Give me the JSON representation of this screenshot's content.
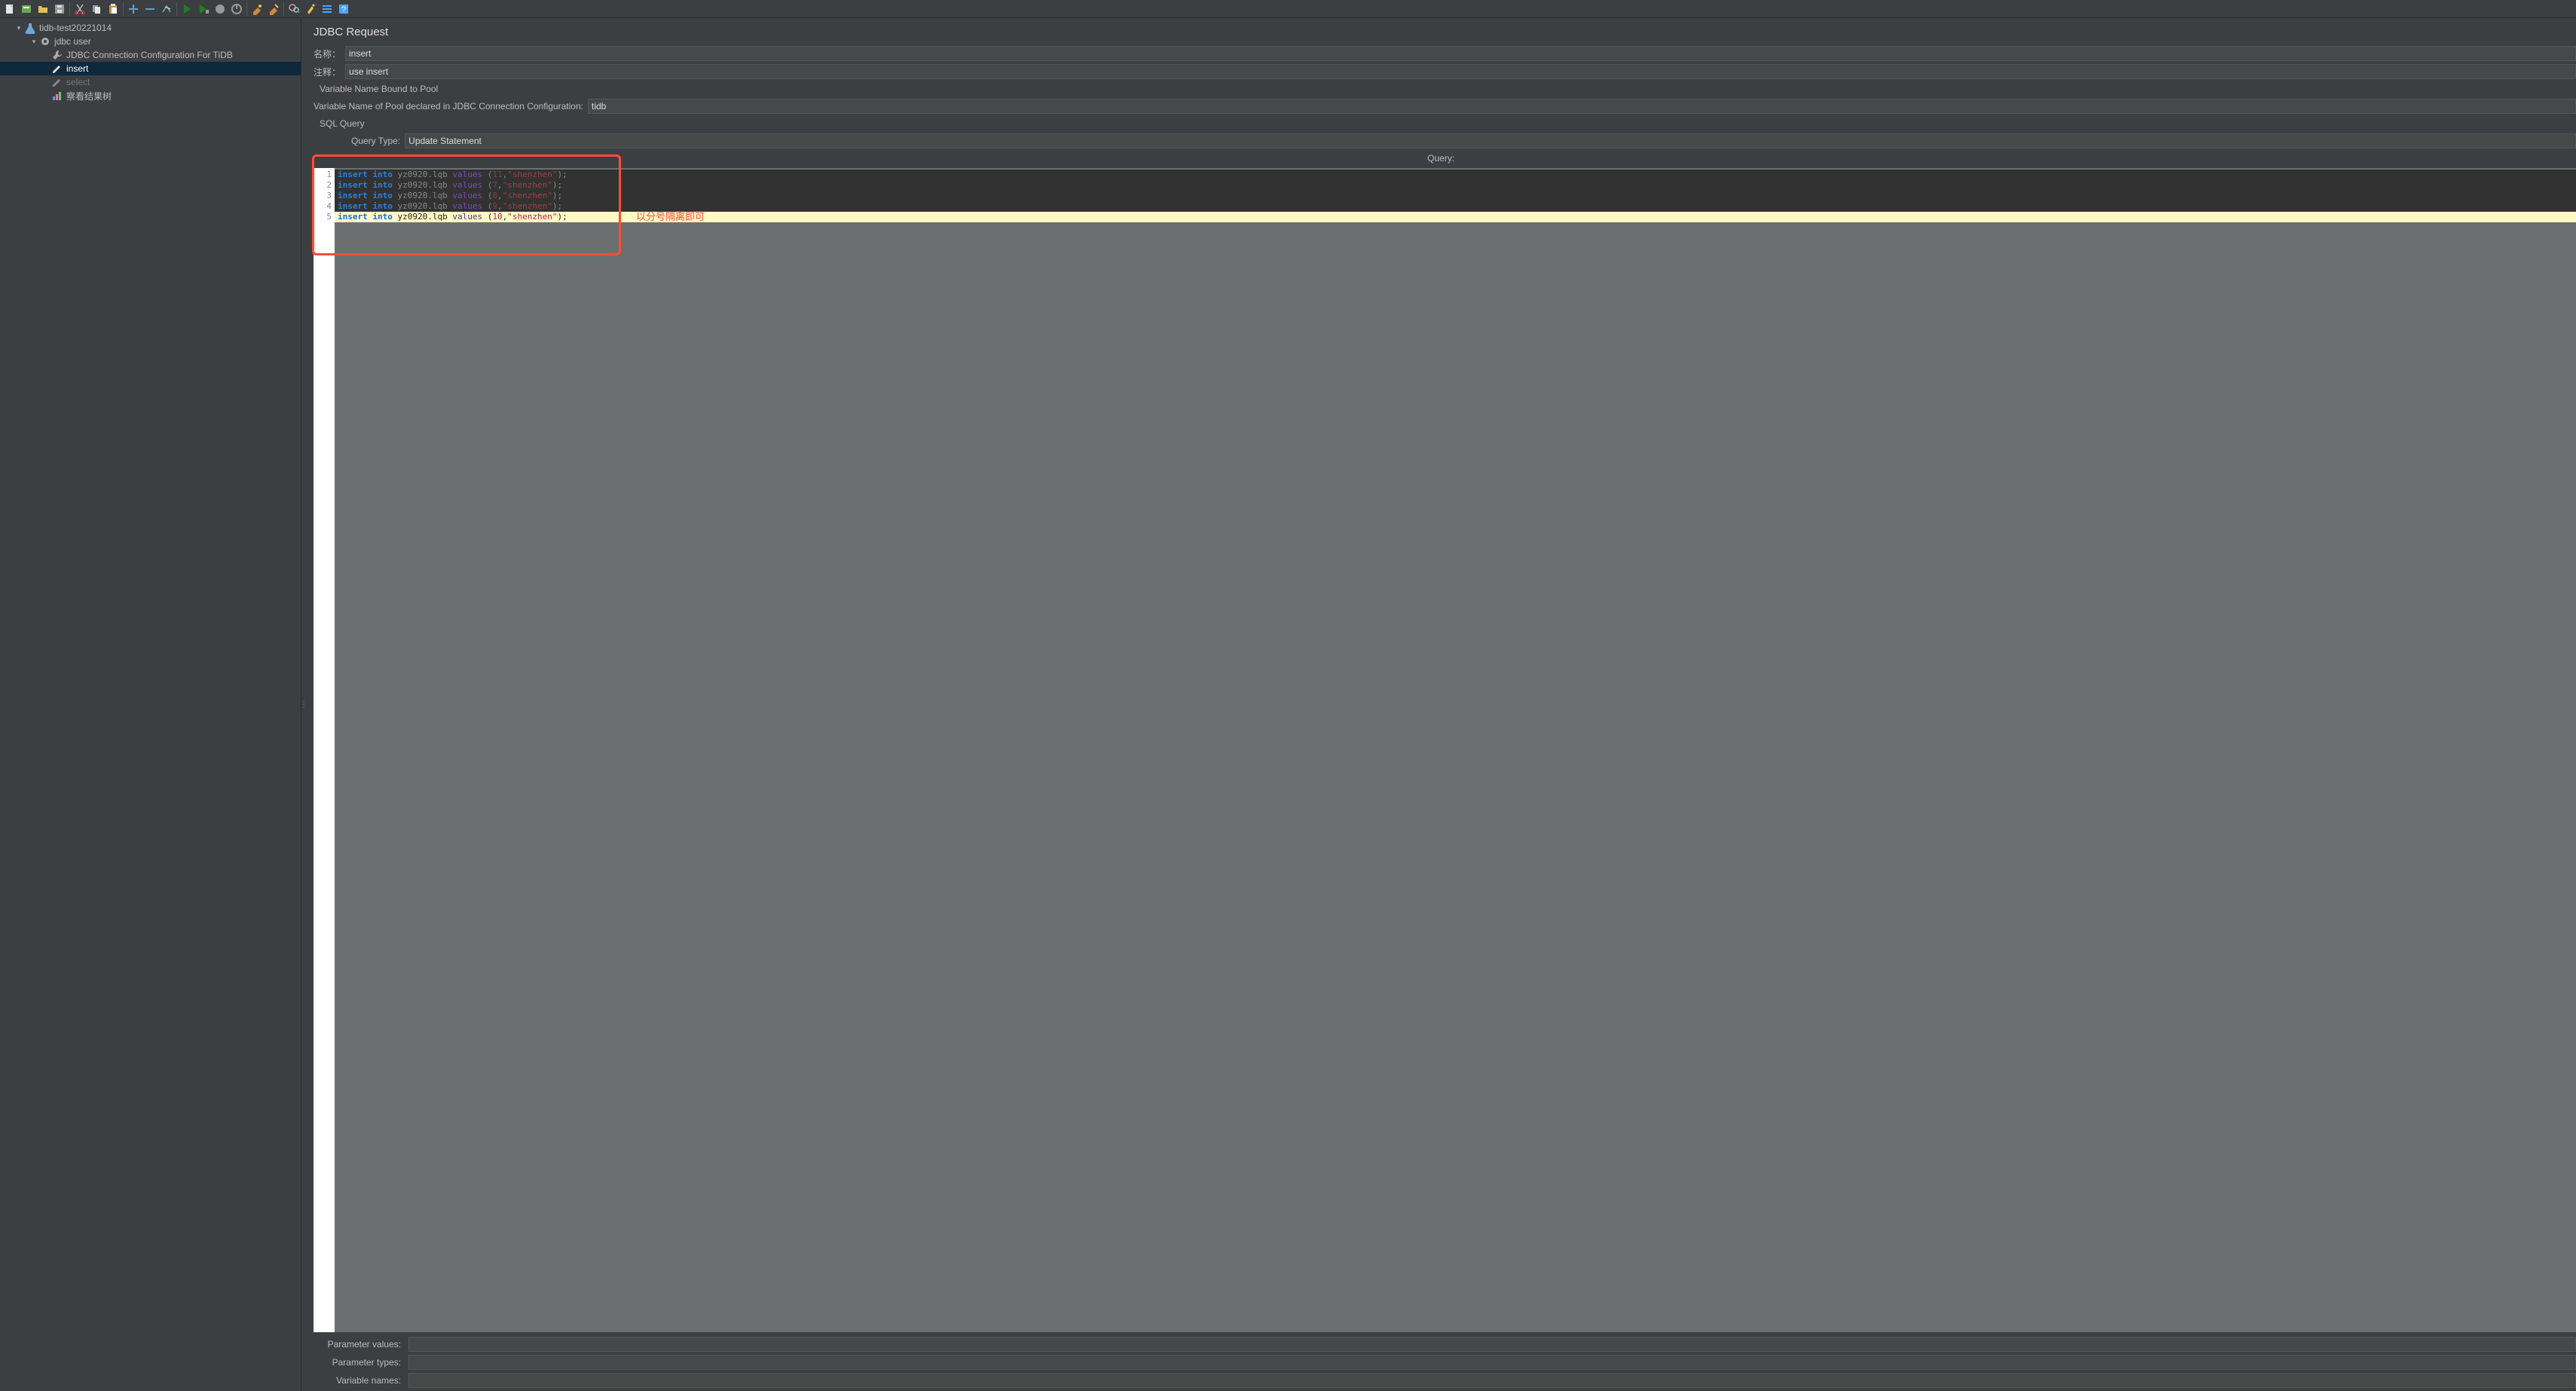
{
  "toolbar": {
    "icons": [
      "new-file-icon",
      "templates-icon",
      "open-icon",
      "save-icon",
      "cut-icon",
      "copy-icon",
      "paste-icon",
      "add-icon",
      "remove-icon",
      "toggle-icon",
      "run-icon",
      "run-nogui-icon",
      "stop-icon",
      "shutdown-icon",
      "clear-icon",
      "clear-all-icon",
      "search-icon",
      "function-helper-icon",
      "options-icon",
      "help-icon"
    ]
  },
  "tree": {
    "root": {
      "label": "tidb-test20221014"
    },
    "group": {
      "label": "jdbc user"
    },
    "config": {
      "label": "JDBC Connection Configuration For TiDB"
    },
    "req_insert": {
      "label": "insert"
    },
    "req_select": {
      "label": "select"
    },
    "listener": {
      "label": "察看结果树"
    }
  },
  "panel": {
    "title": "JDBC Request",
    "name_label": "名称：",
    "name_value": "insert",
    "comment_label": "注释：",
    "comment_value": "use insert",
    "var_bound_label": "Variable Name Bound to Pool",
    "pool_label": "Variable Name of Pool declared in JDBC Connection Configuration:",
    "pool_value": "tidb",
    "sql_query_label": "SQL Query",
    "query_type_label": "Query Type:",
    "query_type_value": "Update Statement",
    "query_header": "Query:"
  },
  "sql": {
    "lines": [
      {
        "n": "1",
        "kw1": "insert",
        "kw2": "into",
        "tbl": "yz0920.lqb",
        "vkw": "values",
        "open": "(",
        "a1": "11",
        "comma": ",",
        "a2": "\"shenzhen\"",
        "close": ")",
        "end": ";"
      },
      {
        "n": "2",
        "kw1": "insert",
        "kw2": "into",
        "tbl": "yz0920.lqb",
        "vkw": "values",
        "open": "(",
        "a1": "7",
        "comma": ",",
        "a2": "\"shenzhen\"",
        "close": ")",
        "end": ";"
      },
      {
        "n": "3",
        "kw1": "insert",
        "kw2": "into",
        "tbl": "yz0920.lqb",
        "vkw": "values",
        "open": "(",
        "a1": "8",
        "comma": ",",
        "a2": "\"shenzhen\"",
        "close": ")",
        "end": ";"
      },
      {
        "n": "4",
        "kw1": "insert",
        "kw2": "into",
        "tbl": "yz0920.lqb",
        "vkw": "values",
        "open": "(",
        "a1": "9",
        "comma": ",",
        "a2": "\"shenzhen\"",
        "close": ")",
        "end": ";"
      },
      {
        "n": "5",
        "kw1": "insert",
        "kw2": "into",
        "tbl": "yz0920.lqb",
        "vkw": "values",
        "open": "(",
        "a1": "10",
        "comma": ",",
        "a2": "\"shenzhen\"",
        "close": ")",
        "end": ";"
      }
    ]
  },
  "annotation": {
    "text": "以分号隔离即可"
  },
  "bottom": {
    "param_values_label": "Parameter values:",
    "param_types_label": "Parameter types:",
    "var_names_label": "Variable names:"
  }
}
